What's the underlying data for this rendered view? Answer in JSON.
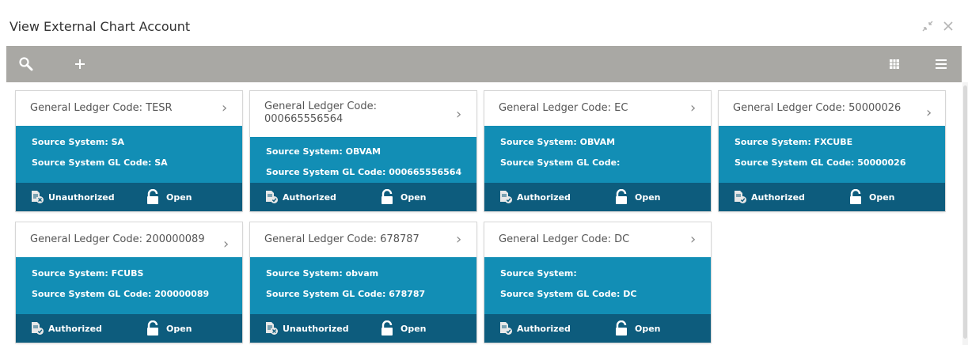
{
  "window": {
    "title": "View External Chart Account",
    "minimize_icon": "minimize-icon",
    "close_icon": "close-icon"
  },
  "toolbar": {
    "search_icon": "search-icon",
    "add_icon": "add-icon",
    "grid_view_icon": "grid-view-icon",
    "list_view_icon": "list-view-icon"
  },
  "colors": {
    "toolbar_bg": "#a9a8a4",
    "card_body_bg": "#128eb5",
    "card_footer_bg": "#0d5c7d"
  },
  "cards": [
    {
      "header": "General Ledger Code:  TESR",
      "source_system": "Source System:  SA",
      "source_gl_code": "Source System GL Code:  SA",
      "auth_status": "Unauthorized",
      "record_status": "Open"
    },
    {
      "header": "General Ledger Code:  000665556564",
      "source_system": "Source System:  OBVAM",
      "source_gl_code": "Source System GL Code:  000665556564",
      "auth_status": "Authorized",
      "record_status": "Open"
    },
    {
      "header": "General Ledger Code:  EC",
      "source_system": "Source System:  OBVAM",
      "source_gl_code": "Source System GL Code:",
      "auth_status": "Authorized",
      "record_status": "Open"
    },
    {
      "header": "General Ledger Code:  50000026",
      "source_system": "Source System:  FXCUBE",
      "source_gl_code": "Source System GL Code:  50000026",
      "auth_status": "Authorized",
      "record_status": "Open"
    },
    {
      "header": "General Ledger Code:  200000089",
      "source_system": "Source System:  FCUBS",
      "source_gl_code": "Source System GL Code:  200000089",
      "auth_status": "Authorized",
      "record_status": "Open"
    },
    {
      "header": "General Ledger Code:  678787",
      "source_system": "Source System:  obvam",
      "source_gl_code": "Source System GL Code:  678787",
      "auth_status": "Unauthorized",
      "record_status": "Open"
    },
    {
      "header": "General Ledger Code:  DC",
      "source_system": "Source System:",
      "source_gl_code": "Source System GL Code:  DC",
      "auth_status": "Authorized",
      "record_status": "Open"
    }
  ]
}
